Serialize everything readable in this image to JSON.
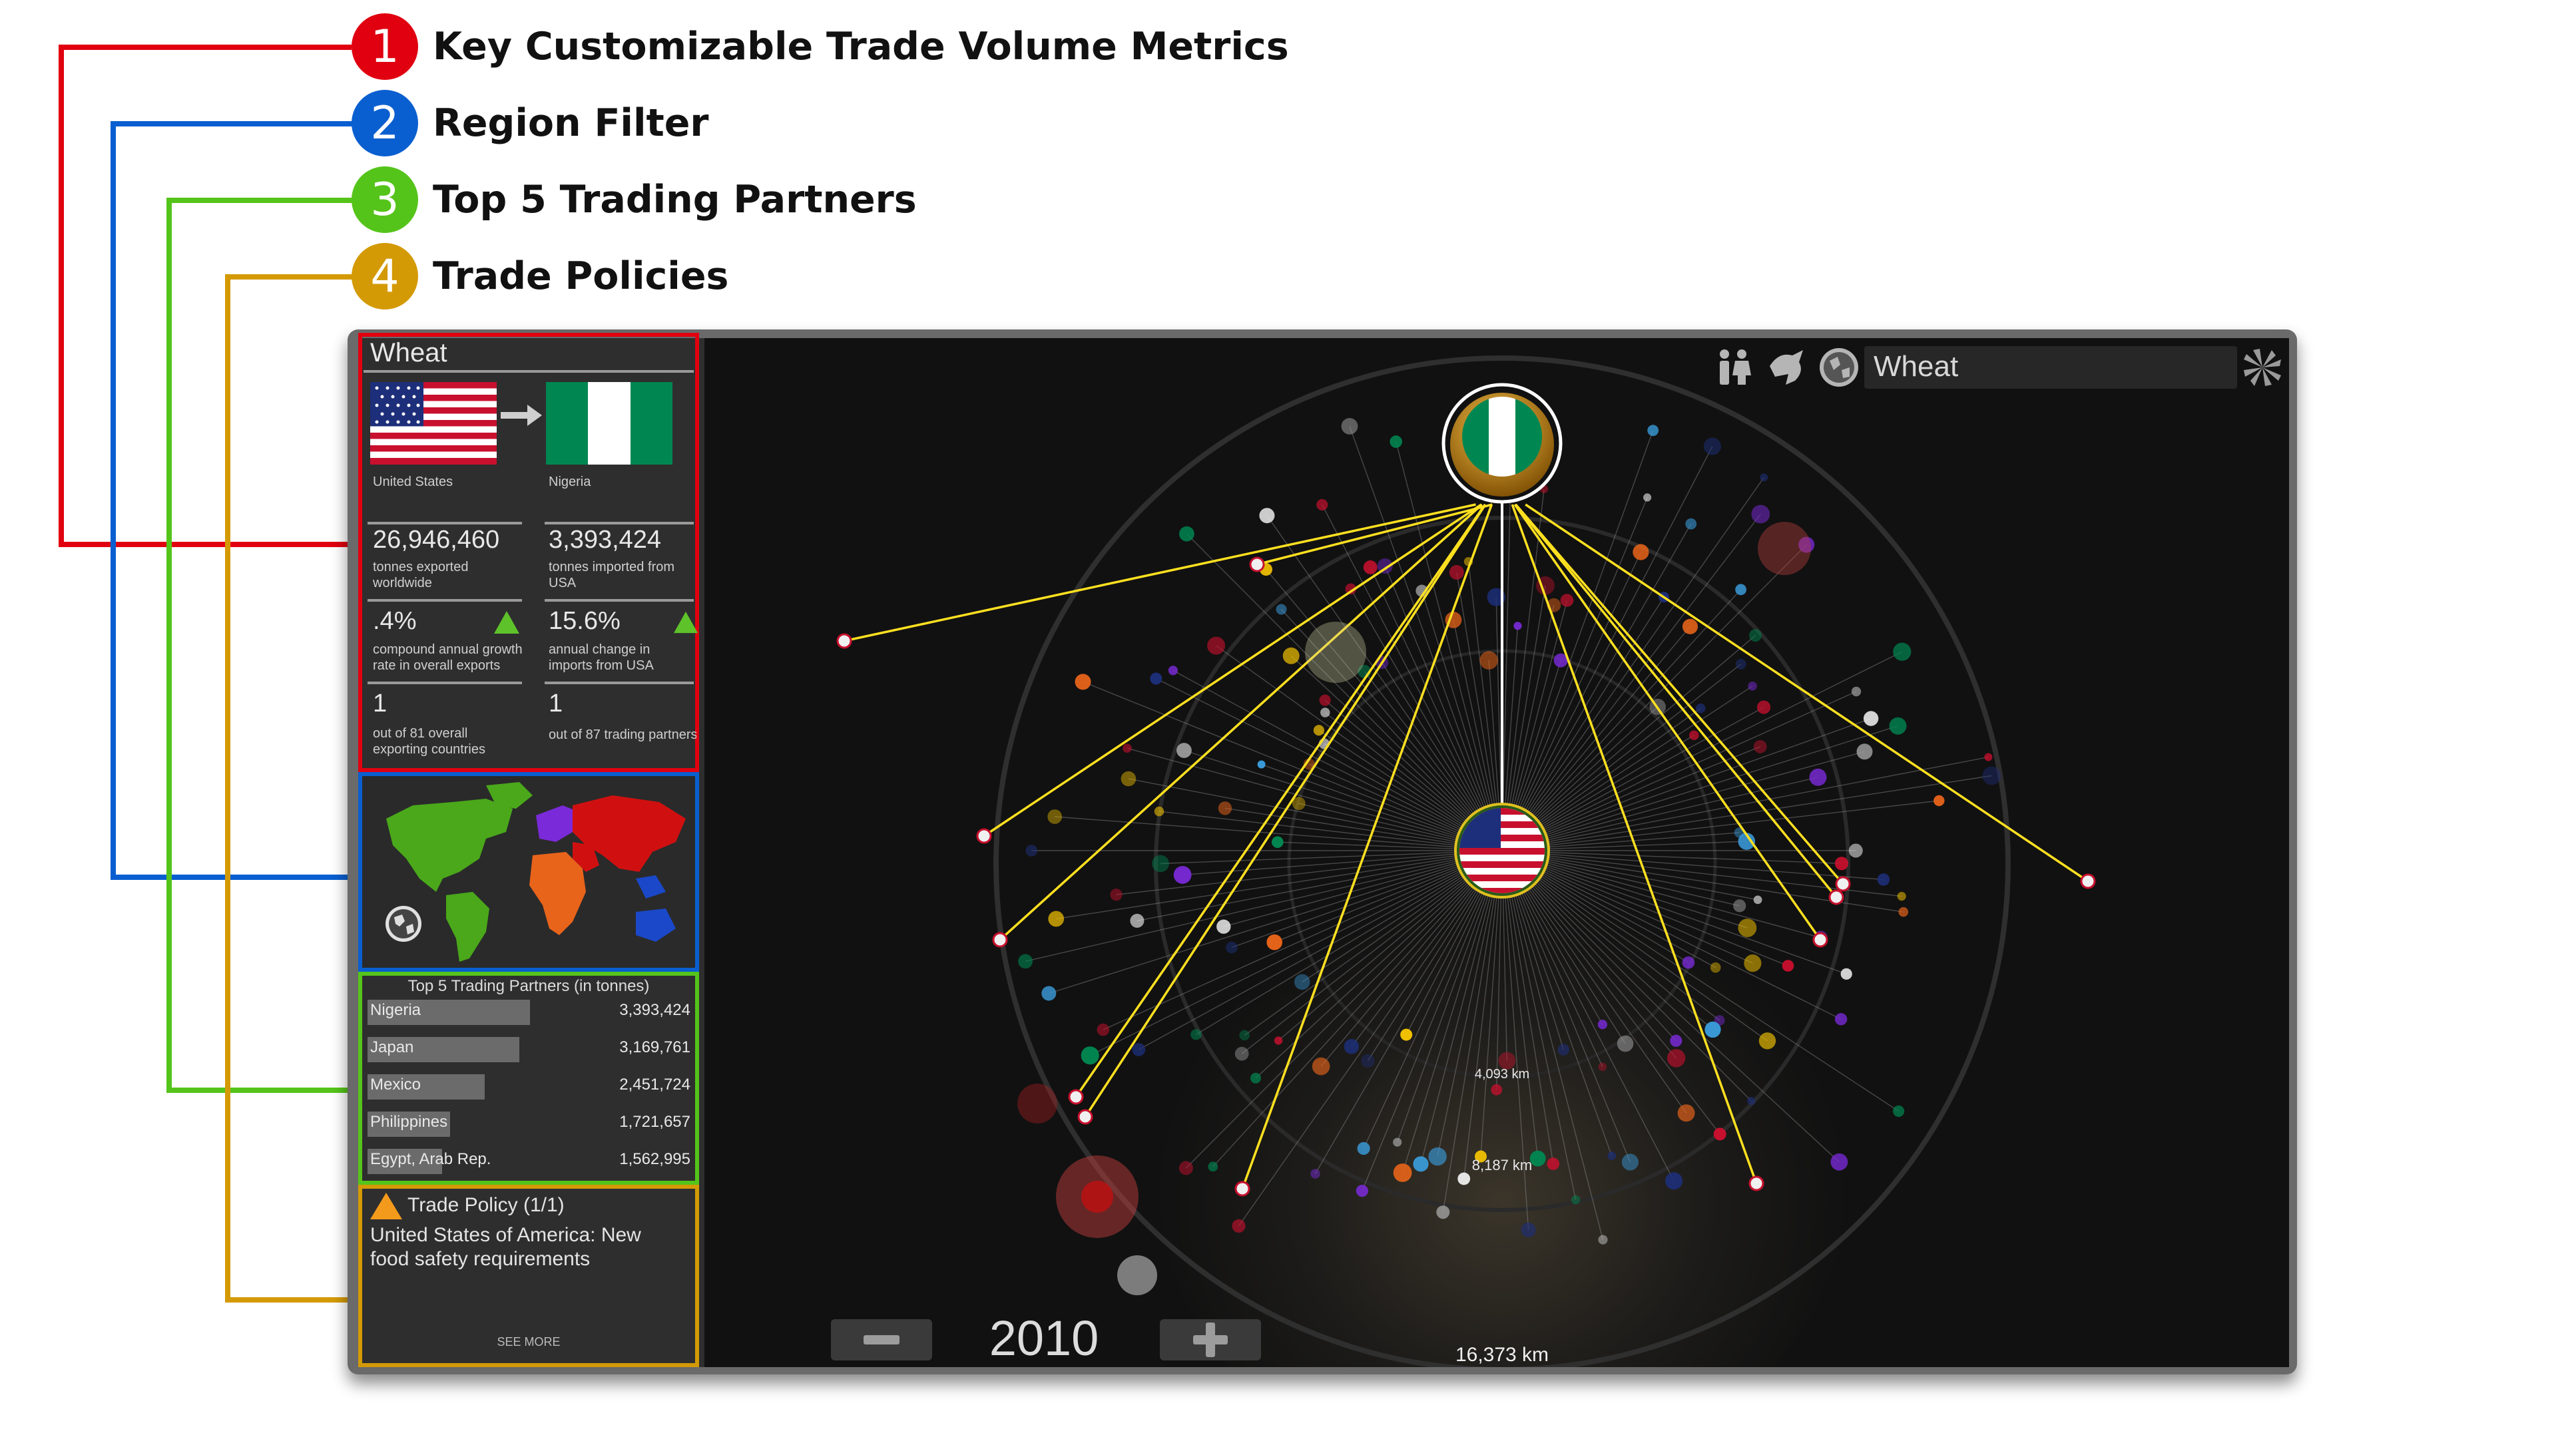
{
  "legend": [
    {
      "number": "1",
      "label": "Key Customizable Trade Volume Metrics",
      "color": "#e00010"
    },
    {
      "number": "2",
      "label": "Region Filter",
      "color": "#0a5fd0"
    },
    {
      "number": "3",
      "label": "Top 5 Trading Partners",
      "color": "#55c41a"
    },
    {
      "number": "4",
      "label": "Trade Policies",
      "color": "#d49a06"
    }
  ],
  "sidebar": {
    "commodity": "Wheat",
    "exporter": "United States",
    "importer": "Nigeria",
    "metrics": [
      {
        "value": "26,946,460",
        "desc": "tonnes exported worldwide"
      },
      {
        "value": "3,393,424",
        "desc": "tonnes imported from USA"
      },
      {
        "value": ".4%",
        "desc": "compound annual growth rate in overall exports"
      },
      {
        "value": "15.6%",
        "desc": "annual change in imports from USA"
      },
      {
        "value": "1",
        "desc": "out of 81 overall exporting countries"
      },
      {
        "value": "1",
        "desc": "out of 87 trading partners"
      }
    ],
    "top_partners": {
      "title": "Top 5 Trading Partners (in tonnes)",
      "rows": [
        {
          "name": "Nigeria",
          "value": "3,393,424",
          "share": 1.0
        },
        {
          "name": "Japan",
          "value": "3,169,761",
          "share": 0.934
        },
        {
          "name": "Mexico",
          "value": "2,451,724",
          "share": 0.722
        },
        {
          "name": "Philippines",
          "value": "1,721,657",
          "share": 0.507
        },
        {
          "name": "Egypt, Arab Rep.",
          "value": "1,562,995",
          "share": 0.46
        }
      ]
    },
    "policy": {
      "title": "Trade Policy (1/1)",
      "text": "United States of America: New food safety requirements",
      "see_more": "SEE MORE"
    }
  },
  "viz": {
    "search_value": "Wheat",
    "year": "2010",
    "distances": [
      "4,093 km",
      "8,187 km",
      "16,373 km"
    ]
  },
  "icons": [
    "folder-icon",
    "layers-icon",
    "filter-icon",
    "people-icon",
    "animal-icon",
    "globe-icon",
    "settings-icon",
    "triangle-up-icon",
    "warning-icon",
    "arrow-right-icon",
    "minus-icon",
    "plus-icon"
  ],
  "colors": {
    "accent_up": "#5ec22a",
    "warning": "#f39a1c",
    "link_line": "#ffe020"
  }
}
